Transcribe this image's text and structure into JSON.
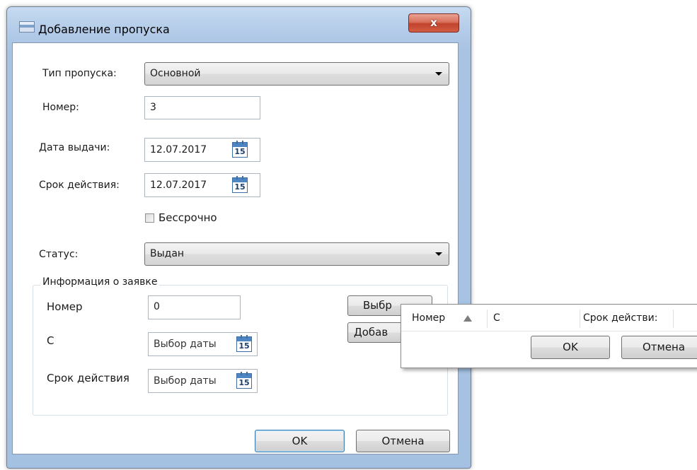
{
  "window": {
    "title": "Добавление пропуска",
    "close_glyph": "x"
  },
  "form": {
    "type": {
      "label": "Тип пропуска:",
      "value": "Основной"
    },
    "number": {
      "label": "Номер:",
      "value": "3"
    },
    "issue_date": {
      "label": "Дата выдачи:",
      "value": "12.07.2017",
      "icon": "calendar-icon",
      "icon_day": "15"
    },
    "valid_until": {
      "label": "Срок действия:",
      "value": "12.07.2017",
      "icon": "calendar-icon",
      "icon_day": "15"
    },
    "unlimited": {
      "label": "Бессрочно",
      "checked": false
    },
    "status": {
      "label": "Статус:",
      "value": "Выдан"
    }
  },
  "request_group": {
    "title": "Информация о заявке",
    "number": {
      "label": "Номер",
      "value": "0"
    },
    "from": {
      "label": "С",
      "placeholder": "Выбор даты",
      "icon_day": "15"
    },
    "valid_until": {
      "label": "Срок действия",
      "placeholder": "Выбор даты",
      "icon_day": "15"
    },
    "select_button": "Выбр",
    "add_button": "Добав"
  },
  "popup": {
    "columns": [
      "Номер",
      "С",
      "Срок действи:"
    ],
    "sort_icon": "sort-ascending-icon",
    "ok": "OK",
    "cancel": "Отмена"
  },
  "buttons": {
    "ok": "OK",
    "cancel": "Отмена"
  },
  "colors": {
    "title_bar": "#b5cde9",
    "close_button": "#c2432c",
    "default_button_border": "#3c7fb1"
  }
}
